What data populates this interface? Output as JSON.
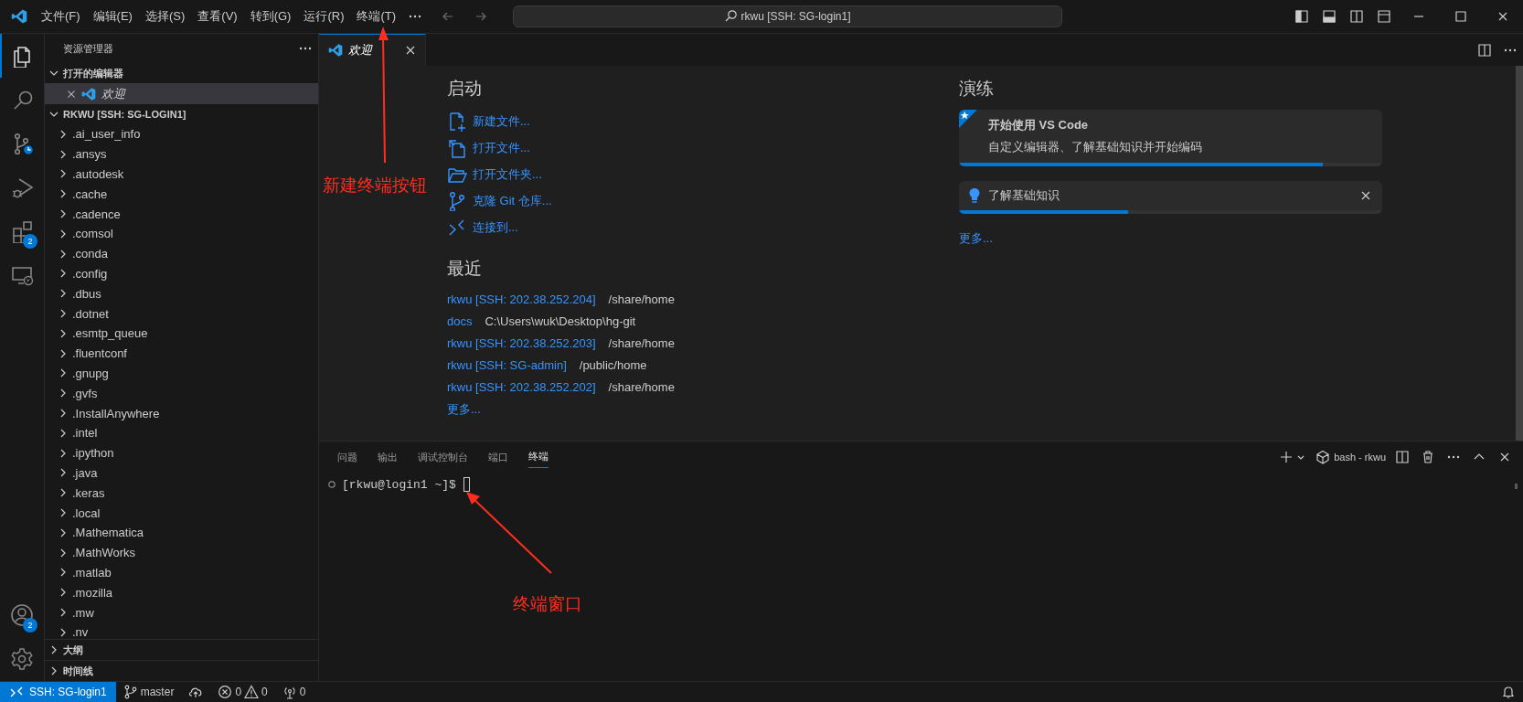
{
  "title_bar": {
    "menus": [
      "文件(F)",
      "编辑(E)",
      "选择(S)",
      "查看(V)",
      "转到(G)",
      "运行(R)",
      "终端(T)"
    ],
    "search": "rkwu [SSH: SG-login1]"
  },
  "activity_bar": {
    "items": [
      {
        "kind": "explorer",
        "selected": true
      },
      {
        "kind": "search",
        "selected": false
      },
      {
        "kind": "source-control",
        "selected": false
      },
      {
        "kind": "run",
        "selected": false
      },
      {
        "kind": "extensions",
        "selected": false,
        "badge": "2"
      },
      {
        "kind": "remote",
        "selected": false
      }
    ],
    "bottom": [
      {
        "kind": "account",
        "badge": "2"
      },
      {
        "kind": "settings"
      }
    ]
  },
  "sidebar": {
    "title": "资源管理器",
    "open_editors": {
      "label": "打开的编辑器",
      "expanded": true,
      "items": [
        {
          "label": "欢迎",
          "selected": true
        }
      ]
    },
    "folder": {
      "label": "RKWU [SSH: SG-LOGIN1]",
      "expanded": true,
      "children": [
        {
          "label": ".ai_user_info",
          "expanded": false
        },
        {
          "label": ".ansys",
          "expanded": false
        },
        {
          "label": ".autodesk",
          "expanded": false
        },
        {
          "label": ".cache",
          "expanded": false
        },
        {
          "label": ".cadence",
          "expanded": false
        },
        {
          "label": ".comsol",
          "expanded": false
        },
        {
          "label": ".conda",
          "expanded": false
        },
        {
          "label": ".config",
          "expanded": false
        },
        {
          "label": ".dbus",
          "expanded": false
        },
        {
          "label": ".dotnet",
          "expanded": false
        },
        {
          "label": ".esmtp_queue",
          "expanded": false
        },
        {
          "label": ".fluentconf",
          "expanded": false
        },
        {
          "label": ".gnupg",
          "expanded": false
        },
        {
          "label": ".gvfs",
          "expanded": false
        },
        {
          "label": ".InstallAnywhere",
          "expanded": false
        },
        {
          "label": ".intel",
          "expanded": false
        },
        {
          "label": ".ipython",
          "expanded": false
        },
        {
          "label": ".java",
          "expanded": false
        },
        {
          "label": ".keras",
          "expanded": false
        },
        {
          "label": ".local",
          "expanded": false
        },
        {
          "label": ".Mathematica",
          "expanded": false
        },
        {
          "label": ".MathWorks",
          "expanded": false
        },
        {
          "label": ".matlab",
          "expanded": false
        },
        {
          "label": ".mozilla",
          "expanded": false
        },
        {
          "label": ".mw",
          "expanded": false
        },
        {
          "label": ".nv",
          "expanded": false
        }
      ]
    },
    "sections": [
      {
        "label": "大纲",
        "expanded": false
      },
      {
        "label": "时间线",
        "expanded": false
      }
    ]
  },
  "editor": {
    "tabs": [
      {
        "label": "欢迎",
        "selected": true
      }
    ],
    "welcome": {
      "start": {
        "title": "启动",
        "items": [
          {
            "kind": "new-file",
            "label": "新建文件..."
          },
          {
            "kind": "open-file",
            "label": "打开文件..."
          },
          {
            "kind": "open-folder",
            "label": "打开文件夹..."
          },
          {
            "kind": "clone",
            "label": "克隆 Git 仓库..."
          },
          {
            "kind": "connect",
            "label": "连接到..."
          }
        ]
      },
      "recent": {
        "title": "最近",
        "items": [
          {
            "name": "rkwu [SSH: 202.38.252.204]",
            "path": "/share/home"
          },
          {
            "name": "docs",
            "path": "C:\\Users\\wuk\\Desktop\\hg-git"
          },
          {
            "name": "rkwu [SSH: 202.38.252.203]",
            "path": "/share/home"
          },
          {
            "name": "rkwu [SSH: SG-admin]",
            "path": "/public/home"
          },
          {
            "name": "rkwu [SSH: 202.38.252.202]",
            "path": "/share/home"
          }
        ],
        "more": "更多..."
      },
      "walkthroughs": {
        "title": "演练",
        "items": [
          {
            "kind": "featured",
            "title": "开始使用 VS Code",
            "description": "自定义编辑器、了解基础知识并开始编码",
            "level": 0.86
          },
          {
            "kind": "tip",
            "title": "了解基础知识",
            "level": 0.4
          }
        ],
        "more": "更多..."
      }
    }
  },
  "panel": {
    "tabs": [
      {
        "label": "问题",
        "selected": false
      },
      {
        "label": "输出",
        "selected": false
      },
      {
        "label": "调试控制台",
        "selected": false
      },
      {
        "label": "端口",
        "selected": false
      },
      {
        "label": "终端",
        "selected": true
      }
    ],
    "terminal_name": "bash - rkwu",
    "prompt": "[rkwu@login1 ~]$"
  },
  "status_bar": {
    "remote": "SSH: SG-login1",
    "branch": "master",
    "errors": "0",
    "warnings": "0",
    "ports": "0"
  },
  "annotations": [
    {
      "kind": "menu-pointer",
      "text": "新建终端按钮"
    },
    {
      "kind": "terminal-pointer",
      "text": "终端窗口"
    }
  ]
}
